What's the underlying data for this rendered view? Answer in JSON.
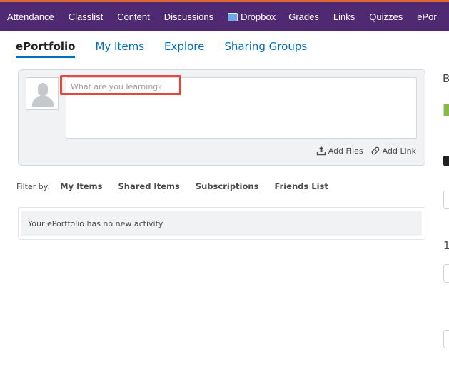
{
  "nav": {
    "items": [
      "Attendance",
      "Classlist",
      "Content",
      "Discussions",
      "Dropbox",
      "Grades",
      "Links",
      "Quizzes",
      "ePor"
    ],
    "colors": {
      "bar": "#4f2a73",
      "accent_line": "#d86a2e"
    }
  },
  "subnav": {
    "tabs": [
      "ePortfolio",
      "My Items",
      "Explore",
      "Sharing Groups"
    ],
    "active": "ePortfolio"
  },
  "composer": {
    "placeholder": "What are you learning?",
    "add_files": "Add Files",
    "add_link": "Add Link",
    "highlight_color": "#e8463c"
  },
  "filter": {
    "label": "Filter by:",
    "items": [
      "My Items",
      "Shared Items",
      "Subscriptions",
      "Friends List"
    ]
  },
  "activity": {
    "empty_message": "Your ePortfolio has no new activity"
  },
  "sidebar": {
    "partial_letter": "B",
    "partial_number": "1"
  },
  "icons": [
    "dropbox-icon",
    "avatar-placeholder-icon",
    "upload-icon",
    "link-icon"
  ]
}
